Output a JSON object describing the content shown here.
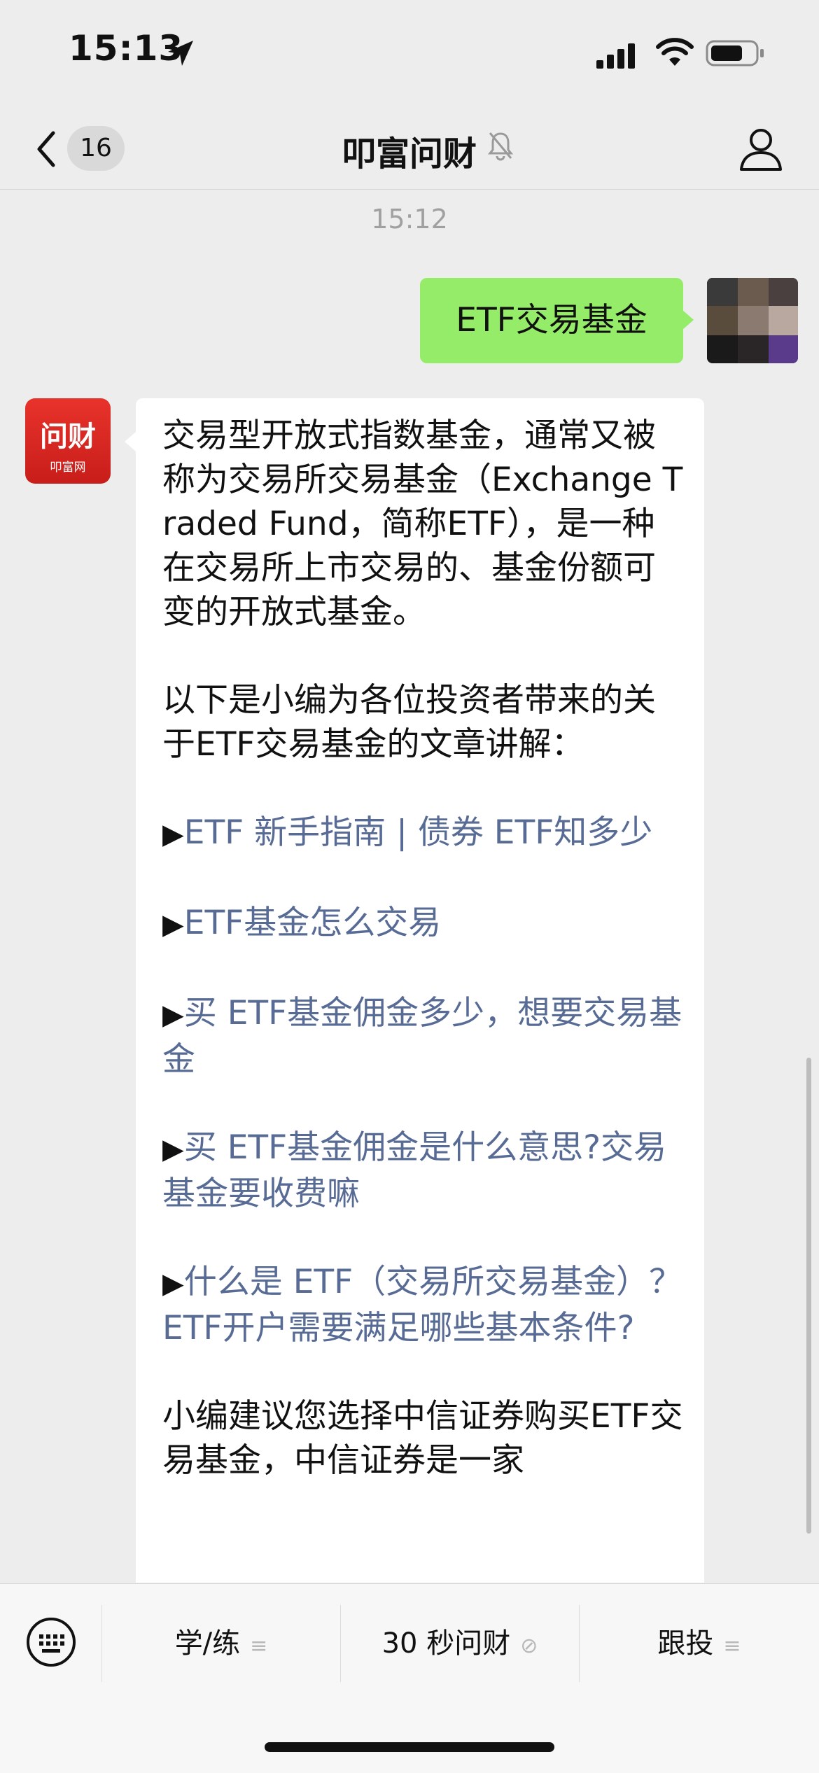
{
  "status_bar": {
    "time": "15:13",
    "icons": [
      "location-arrow-icon",
      "cellular-signal-icon",
      "wifi-icon",
      "battery-icon"
    ]
  },
  "nav": {
    "unread_count": "16",
    "title": "叩富问财",
    "icons": [
      "back-chevron-icon",
      "bell-muted-icon",
      "profile-icon"
    ]
  },
  "chat": {
    "timestamp": "15:12",
    "user_message": "ETF交易基金",
    "bot_avatar": {
      "main": "问财",
      "sub": "叩富网"
    },
    "bot_message": {
      "intro": "交易型开放式指数基金，通常又被称为交易所交易基金（Exchange Traded Fund，简称ETF），是一种在交易所上市交易的、基金份额可变的开放式基金。",
      "lead": "以下是小编为各位投资者带来的关于ETF交易基金的文章讲解：",
      "arrow": "▶",
      "links": [
        "ETF 新手指南 | 债券 ETF知多少",
        "ETF基金怎么交易",
        "买 ETF基金佣金多少，想要交易基金",
        "买 ETF基金佣金是什么意思?交易基金要收费嘛",
        "什么是 ETF（交易所交易基金）？ETF开户需要满足哪些基本条件?"
      ],
      "closing": "小编建议您选择中信证券购买ETF交易基金，中信证券是一家"
    }
  },
  "bottom_menu": {
    "items": [
      {
        "label": "学/练",
        "glyph": "≡"
      },
      {
        "label": "30 秒问财",
        "glyph": "⊘"
      },
      {
        "label": "跟投",
        "glyph": "≡"
      }
    ]
  },
  "colors": {
    "background": "#ededed",
    "my_bubble": "#95ec69",
    "link": "#576b95",
    "brand_red": "#d9261f"
  }
}
